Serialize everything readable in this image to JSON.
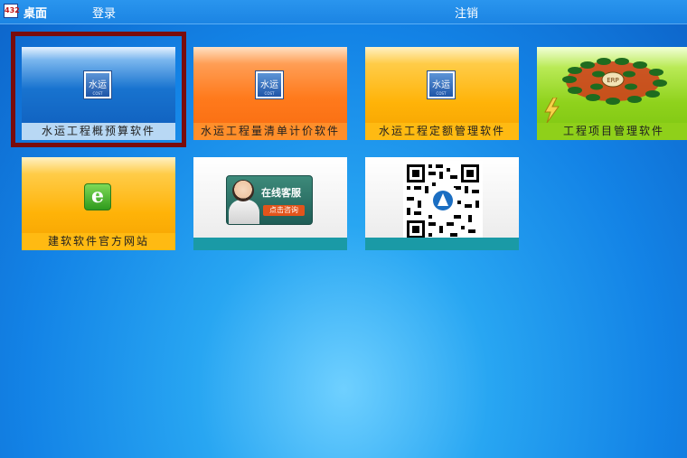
{
  "topbar": {
    "logo_text": "432",
    "title": "桌面",
    "login": "登录",
    "logout": "注销"
  },
  "tiles": [
    {
      "caption": "水运工程概预算软件",
      "theme": "blue",
      "icon": "cost-app-icon",
      "icon_text": "水运",
      "icon_sub": "COST",
      "selected": true
    },
    {
      "caption": "水运工程量清单计价软件",
      "theme": "orange",
      "icon": "cost-app-icon",
      "icon_text": "水运",
      "icon_sub": "COST"
    },
    {
      "caption": "水运工程定额管理软件",
      "theme": "yellow",
      "icon": "cost-app-icon",
      "icon_text": "水运",
      "icon_sub": "COST"
    },
    {
      "caption": "工程项目管理软件",
      "theme": "green",
      "icon": "erp-diagram-icon",
      "icon_text": "ERP"
    },
    {
      "caption": "建软软件官方网站",
      "theme": "yellow",
      "icon": "ie-browser-icon",
      "icon_text": "e"
    },
    {
      "caption": "",
      "theme": "white",
      "icon": "online-service-banner",
      "banner_label": "在线客服",
      "banner_button": "点击咨询"
    },
    {
      "caption": "",
      "theme": "white",
      "icon": "qr-code-icon"
    }
  ],
  "colors": {
    "selection_frame": "#7a0c0c",
    "tile_footer_teal": "#1a9aa6"
  }
}
